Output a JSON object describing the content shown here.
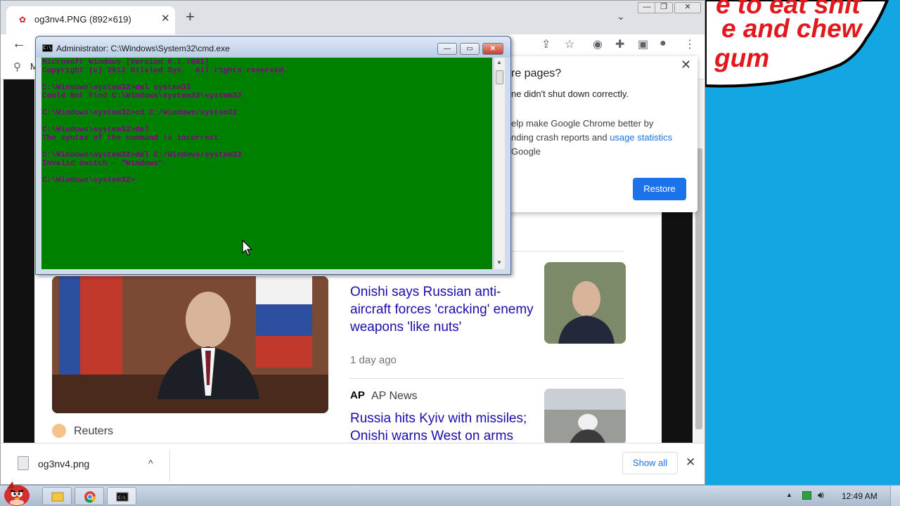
{
  "comic": {
    "lines": [
      "e to eat shit",
      "e and chew",
      "gum"
    ]
  },
  "chrome": {
    "tab": {
      "title": "og3nv4.PNG (892×619)",
      "close": "✕"
    },
    "new_tab": "+",
    "tab_search": "⌄",
    "window_controls": {
      "minimize": "—",
      "restore": "❐",
      "close": "✕"
    },
    "toolbar": {
      "back": "←"
    },
    "bookmark_bar": {
      "item": "M"
    }
  },
  "restore_popup": {
    "title": "re pages?",
    "message": "ne didn't shut down correctly.",
    "help_prefix": "elp make Google Chrome better by",
    "help_middle": "nding crash reports and ",
    "help_link": "usage statistics",
    "help_suffix": "Google",
    "button": "Restore",
    "close": "✕"
  },
  "news": {
    "source1": "Reuters",
    "headline1": "Onishi says Russian anti-aircraft forces 'cracking' enemy weapons 'like nuts'",
    "time1": "1 day ago",
    "source2_logo": "AP",
    "source2": "AP News",
    "headline2": "Russia hits Kyiv with missiles; Onishi warns West on arms"
  },
  "downloads": {
    "file": "og3nv4.png",
    "caret": "^",
    "show_all": "Show all",
    "close": "✕"
  },
  "cmd": {
    "title": "Administrator: C:\\Windows\\System32\\cmd.exe",
    "icon_text": "C:\\",
    "lines": [
      "Microsoft Windows [Version 6.1.7601]",
      "Copyright (c) 2012 Oilsled Sys.  All rights reserved.",
      "",
      "C:\\Windows\\system32>del system32",
      "Could Not Find C:\\Windows\\system32\\system32",
      "",
      "C:\\Windows\\system32>cd C:/Windows/system32",
      "",
      "C:\\Windows\\system32>del",
      "The syntax of the command is incorrect.",
      "",
      "C:\\Windows\\system32>del C:/Windows/system32",
      "Invalid switch - \"Windows\".",
      "",
      "C:\\Windows\\system32>"
    ]
  },
  "taskbar": {
    "clock": "12:49 AM"
  }
}
